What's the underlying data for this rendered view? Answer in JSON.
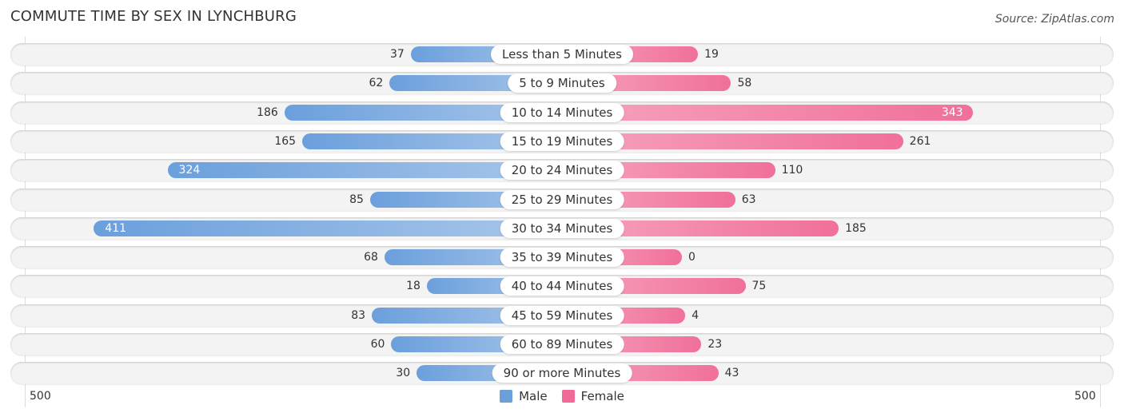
{
  "header": {
    "title": "COMMUTE TIME BY SEX IN LYNCHBURG",
    "source": "Source: ZipAtlas.com"
  },
  "colors": {
    "male": "#6a9fdc",
    "female": "#f06b97"
  },
  "chart_data": {
    "type": "bar",
    "orientation": "horizontal-diverging",
    "title": "COMMUTE TIME BY SEX IN LYNCHBURG",
    "categories": [
      "Less than 5 Minutes",
      "5 to 9 Minutes",
      "10 to 14 Minutes",
      "15 to 19 Minutes",
      "20 to 24 Minutes",
      "25 to 29 Minutes",
      "30 to 34 Minutes",
      "35 to 39 Minutes",
      "40 to 44 Minutes",
      "45 to 59 Minutes",
      "60 to 89 Minutes",
      "90 or more Minutes"
    ],
    "series": [
      {
        "name": "Male",
        "values": [
          37,
          62,
          186,
          165,
          324,
          85,
          411,
          68,
          18,
          83,
          60,
          30
        ]
      },
      {
        "name": "Female",
        "values": [
          19,
          58,
          343,
          261,
          110,
          63,
          185,
          0,
          75,
          4,
          23,
          43
        ]
      }
    ],
    "axis": {
      "left_tick": "500",
      "right_tick": "500",
      "range": [
        0,
        500
      ]
    },
    "legend": [
      "Male",
      "Female"
    ],
    "legend_position": "bottom-center"
  }
}
